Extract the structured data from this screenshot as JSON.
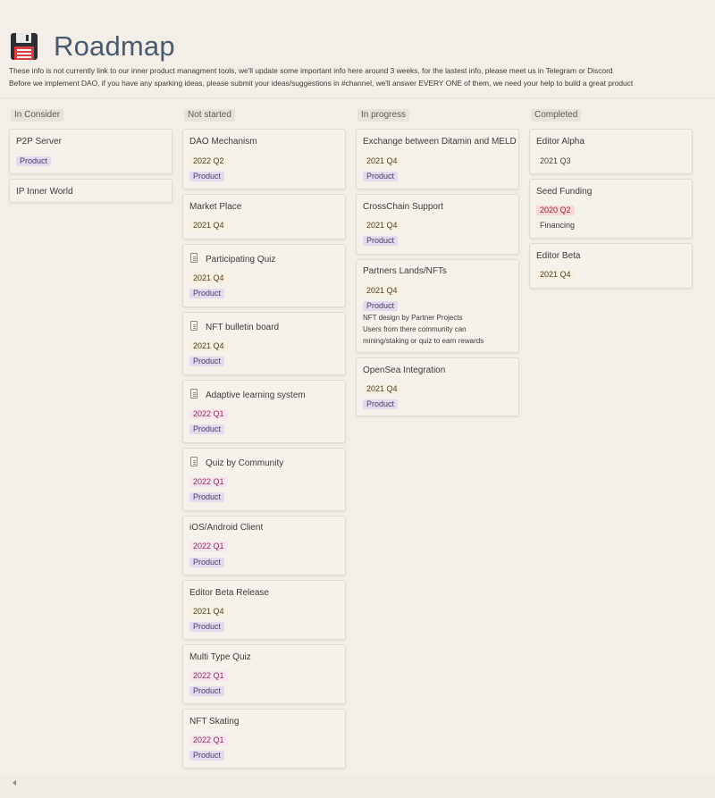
{
  "page": {
    "title": "Roadmap",
    "icon": "floppy-disk-icon",
    "description_line1": "These info is not currently link to our inner product managment tools, we'll update some important info here around 3 weeks, for the lastest info, please meet us in Telegram or Discord",
    "description_line2": "Before we implement DAO, if you have any sparking ideas, please submit your ideas/suggestions in #channel, we'll answer EVERY ONE of them, we need your help to build a great product"
  },
  "columns": [
    {
      "name": "In Consider",
      "cards": [
        {
          "title": "P2P Server",
          "tags": [
            "Product"
          ]
        },
        {
          "title": "IP Inner World",
          "tags": []
        }
      ]
    },
    {
      "name": "Not started",
      "cards": [
        {
          "title": "DAO Mechanism",
          "date": "2022 Q2",
          "tags": [
            "Product"
          ]
        },
        {
          "title": "Market Place",
          "date": "2021 Q4",
          "tags": []
        },
        {
          "title": "Participating Quiz",
          "date": "2021 Q4",
          "tags": [
            "Product"
          ],
          "icon": "document-icon"
        },
        {
          "title": "NFT bulletin board",
          "date": "2021 Q4",
          "tags": [
            "Product"
          ],
          "icon": "document-icon"
        },
        {
          "title": "Adaptive learning system",
          "date": "2022 Q1",
          "tags": [
            "Product"
          ],
          "icon": "document-icon"
        },
        {
          "title": "Quiz by Community",
          "date": "2022 Q1",
          "tags": [
            "Product"
          ],
          "icon": "document-icon"
        },
        {
          "title": "iOS/Android Client",
          "date": "2022 Q1",
          "tags": [
            "Product"
          ]
        },
        {
          "title": "Editor Beta Release",
          "date": "2021 Q4",
          "tags": [
            "Product"
          ]
        },
        {
          "title": "Multi Type Quiz",
          "date": "2022 Q1",
          "tags": [
            "Product"
          ]
        },
        {
          "title": "NFT Skating",
          "date": "2022 Q1",
          "tags": [
            "Product"
          ]
        }
      ]
    },
    {
      "name": "In progress",
      "cards": [
        {
          "title": "Exchange between Ditamin and MELD",
          "date": "2021 Q4",
          "tags": [
            "Product"
          ]
        },
        {
          "title": "CrossChain Support",
          "date": "2021 Q4",
          "tags": [
            "Product"
          ]
        },
        {
          "title": "Partners Lands/NFTs",
          "date": "2021 Q4",
          "tags": [
            "Product"
          ],
          "notes": [
            "NFT design by Partner Projects",
            "Users from there community can",
            "mining/staking or quiz to earn rewards"
          ]
        },
        {
          "title": "OpenSea Integration",
          "date": "2021 Q4",
          "tags": [
            "Product"
          ]
        }
      ]
    },
    {
      "name": "Completed",
      "cards": [
        {
          "title": "Editor Alpha",
          "date": "2021 Q3",
          "tags": []
        },
        {
          "title": "Seed Funding",
          "date": "2020 Q2",
          "tags": [
            "Financing"
          ]
        },
        {
          "title": "Editor Beta",
          "date": "2021 Q4",
          "tags": []
        }
      ]
    }
  ],
  "colors": {
    "background": "#f3efe8",
    "title": "#4a5a6e",
    "product_tag": "#e4dcee",
    "q4_tag": "#f8f0dc",
    "q1_tag": "#f8e4ec",
    "q2_red_tag": "#f7d8d8"
  }
}
